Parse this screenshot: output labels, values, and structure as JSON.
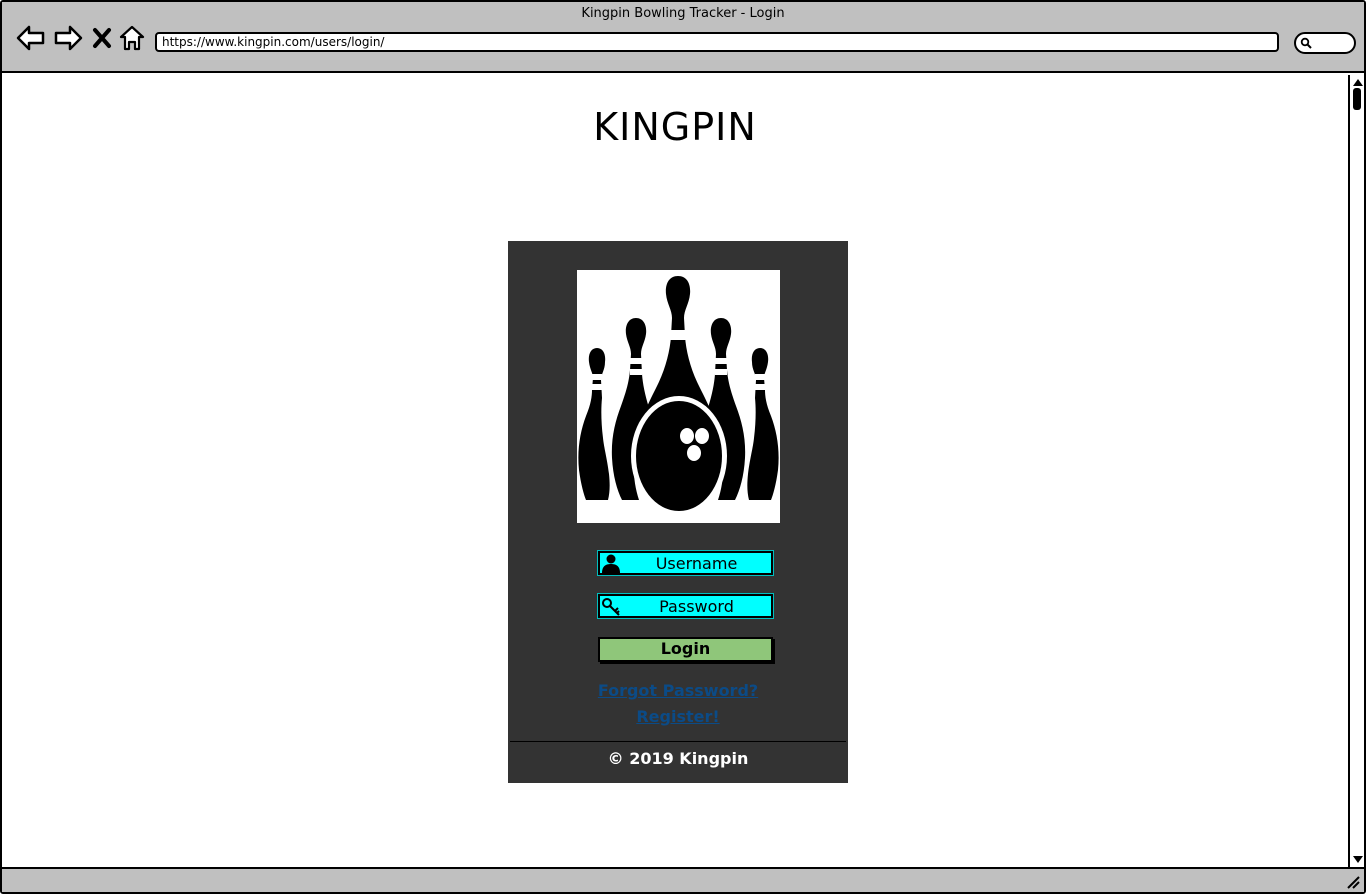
{
  "window": {
    "title": "Kingpin Bowling Tracker - Login",
    "url": "https://www.kingpin.com/users/login/"
  },
  "page": {
    "site_title": "KINGPIN"
  },
  "login_form": {
    "username_placeholder": "Username",
    "password_placeholder": "Password",
    "login_label": "Login",
    "forgot_password_label": "Forgot Password?",
    "register_label": "Register!"
  },
  "footer": {
    "copyright": "© 2019 Kingpin"
  },
  "icons": {
    "back": "back-arrow-icon",
    "forward": "forward-arrow-icon",
    "stop": "close-icon",
    "home": "home-icon",
    "search": "search-icon",
    "username": "user-icon",
    "password": "key-icon",
    "logo": "bowling-pins-logo"
  },
  "colors": {
    "card_background": "#333333",
    "input_background": "#00ffff",
    "login_button": "#8fc67a",
    "link": "#0b4b87",
    "chrome": "#c0c0c0"
  }
}
